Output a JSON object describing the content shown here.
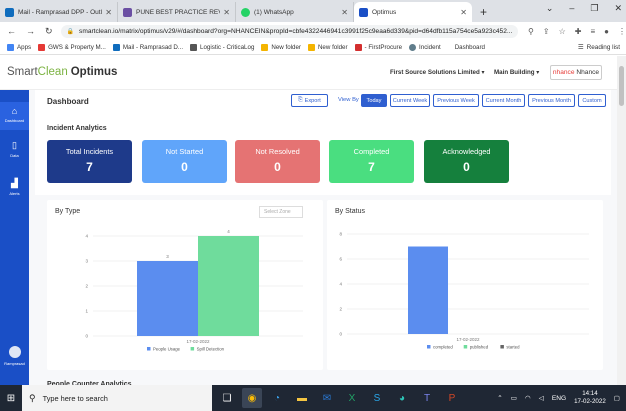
{
  "browser": {
    "tabs": [
      {
        "label": "Mail - Ramprasad DPP - Outlook",
        "color": "#0f6cbd",
        "icon": "outlook-icon"
      },
      {
        "label": "PUNE BEST PRACTICE REVIEW FO",
        "color": "#6b4fa3",
        "icon": "document-icon"
      },
      {
        "label": "(1) WhatsApp",
        "color": "#25d366",
        "icon": "whatsapp-icon"
      },
      {
        "label": "Optimus",
        "color": "#1a4fc6",
        "icon": "optimus-icon"
      }
    ],
    "url": "smartclean.io/matrix/optimus/v29/#/dashboard?org=NHANCEIN&propId=cbfe4322446941c3991f25c9eaa6d339&pid=d64dfb115a754ce5a923c452...",
    "bookmarks": [
      {
        "label": "Apps",
        "color": "#4285f4"
      },
      {
        "label": "GWS & Property M...",
        "color": "#e53935"
      },
      {
        "label": "Mail - Ramprasad D...",
        "color": "#0f6cbd"
      },
      {
        "label": "Logistic - CriticaLog",
        "color": "#555555"
      },
      {
        "label": "New folder",
        "color": "#f4b400"
      },
      {
        "label": "New folder",
        "color": "#f4b400"
      },
      {
        "label": "- FirstProcure",
        "color": "#d32f2f"
      },
      {
        "label": "Incident",
        "color": "#607d8b"
      },
      {
        "label": "Dashboard",
        "color": "#9e9e9e"
      }
    ],
    "reading_list": "Reading list"
  },
  "app": {
    "logo_smart": "Smart",
    "logo_clean": "Clean",
    "logo_product": "Optimus",
    "org_selector": "First Source Solutions Limited",
    "building_selector": "Main Building",
    "user_prefix": "nhance",
    "user_name": "Nhance"
  },
  "sidebar": {
    "items": [
      {
        "label": "Dashboard",
        "icon": "home-icon"
      },
      {
        "label": "Data",
        "icon": "document-icon"
      },
      {
        "label": "Alerts",
        "icon": "bar-chart-icon"
      }
    ],
    "user": "Ramprasad"
  },
  "dashboard": {
    "title": "Dashboard",
    "export_label": "Export",
    "view_by_label": "View By",
    "periods": [
      "Today",
      "Current Week",
      "Previous Week",
      "Current Month",
      "Previous Month",
      "Custom"
    ],
    "active_period": "Today"
  },
  "incident_analytics": {
    "title": "Incident Analytics",
    "cards": [
      {
        "label": "Total Incidents",
        "value": "7",
        "color": "#1e3a8a"
      },
      {
        "label": "Not Started",
        "value": "0",
        "color": "#60a5fa"
      },
      {
        "label": "Not Resolved",
        "value": "0",
        "color": "#e57373"
      },
      {
        "label": "Completed",
        "value": "7",
        "color": "#4ade80"
      },
      {
        "label": "Acknowledged",
        "value": "0",
        "color": "#15803d"
      }
    ]
  },
  "by_type": {
    "title": "By Type",
    "zone_placeholder": "Select Zone"
  },
  "by_status": {
    "title": "By Status"
  },
  "chart_data": [
    {
      "type": "bar",
      "title": "By Type",
      "categories": [
        "17-02-2022"
      ],
      "series": [
        {
          "name": "People Usage",
          "values": [
            3
          ],
          "color": "#5b8def"
        },
        {
          "name": "Spill Detection",
          "values": [
            4
          ],
          "color": "#6fdc9c"
        }
      ],
      "data_labels": [
        "3",
        "4"
      ],
      "ylim": [
        0,
        4
      ],
      "yticks": [
        "0",
        "1",
        "2",
        "3",
        "4"
      ],
      "legend": "bottom"
    },
    {
      "type": "bar",
      "title": "By Status",
      "categories": [
        "17-02-2022"
      ],
      "series": [
        {
          "name": "completed",
          "values": [
            7
          ],
          "color": "#5b8def"
        },
        {
          "name": "published",
          "values": [
            0
          ],
          "color": "#6fdc9c"
        },
        {
          "name": "started",
          "values": [
            0
          ],
          "color": "#666666"
        }
      ],
      "ylim": [
        0,
        8
      ],
      "yticks": [
        "0",
        "2",
        "4",
        "6",
        "8"
      ],
      "legend": "bottom"
    }
  ],
  "next_section": "People Counter Analytics",
  "taskbar": {
    "search_placeholder": "Type here to search",
    "language": "ENG",
    "time": "14:14",
    "date": "17-02-2022"
  }
}
